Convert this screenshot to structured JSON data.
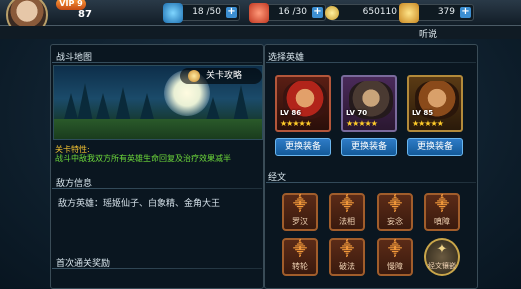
{
  "topbar": {
    "vip": "VIP 9",
    "level": "87",
    "stamina": "18 /50",
    "energy": "16 /30",
    "coins": "650110",
    "gems": "379",
    "listen": "听说"
  },
  "left": {
    "map_title": "战斗地图",
    "guide_label": "关卡攻略",
    "feature_title": "关卡特性:",
    "feature_desc": "战斗中敌我双方所有英雄生命回复及治疗效果减半",
    "enemy_title": "敌方信息",
    "enemy_heroes": "敌方英雄：瑶姬仙子、白象精、金角大王",
    "reward_title": "首次通关奖励"
  },
  "right": {
    "heroes_title": "选择英雄",
    "heroes": [
      {
        "level": "LV 86",
        "stars": "★★★★★",
        "button": "更换装备"
      },
      {
        "level": "LV 70",
        "stars": "★★★★★",
        "button": "更换装备"
      },
      {
        "level": "LV 85",
        "stars": "★★★★★",
        "button": "更换装备"
      }
    ],
    "runes_title": "经文",
    "runes": [
      "罗汉",
      "法相",
      "妄念",
      "嗔障",
      "转轮",
      "破法",
      "慢障",
      "经文镶嵌"
    ]
  },
  "colors": {
    "accent": "#2e7bc6",
    "star": "#ffcc2a",
    "feature_title": "#f3c232",
    "feature_text": "#6edb3a",
    "rune": "#a15d2b"
  }
}
